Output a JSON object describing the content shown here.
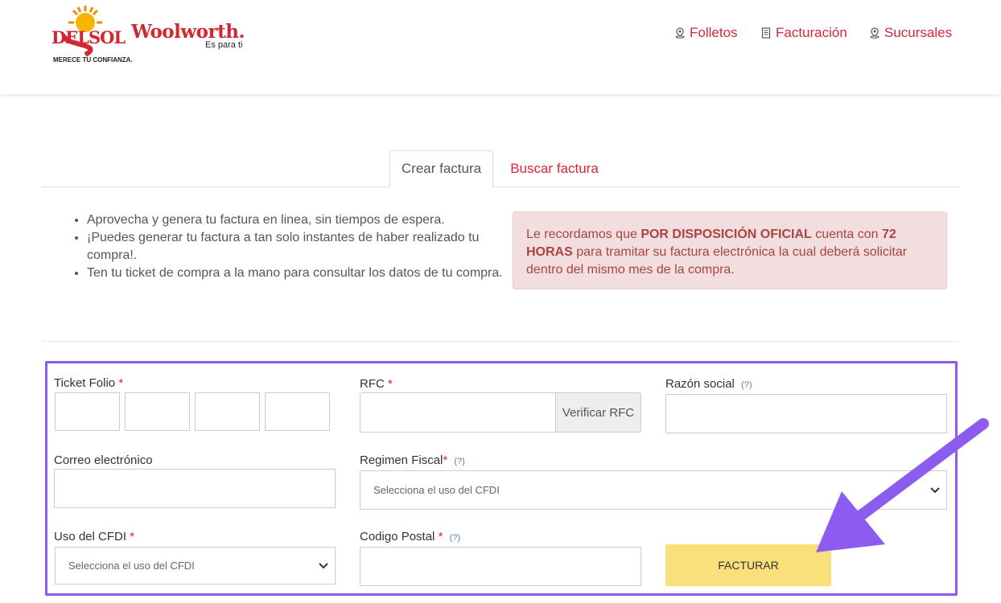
{
  "header": {
    "logo_delsol": {
      "word": "DELSOL",
      "tagline": "MERECE TU CONFIANZA."
    },
    "logo_woolworth": {
      "brand": "Woolworth.",
      "tagline": "Es para ti"
    },
    "nav": [
      {
        "label": "Folletos",
        "icon": "map-pin-icon"
      },
      {
        "label": "Facturación",
        "icon": "document-icon"
      },
      {
        "label": "Sucursales",
        "icon": "map-pin-icon"
      }
    ]
  },
  "tabs": [
    {
      "label": "Crear factura",
      "active": true
    },
    {
      "label": "Buscar factura",
      "active": false
    }
  ],
  "info": {
    "items": [
      "Aprovecha y genera tu factura en linea, sin tiempos de espera.",
      "¡Puedes generar tu factura a tan solo instantes de haber realizado tu compra!.",
      "Ten tu ticket de compra a la mano para consultar los datos de tu compra."
    ]
  },
  "alert": {
    "pre": "Le recordamos que ",
    "bold1": "POR DISPOSICIÓN OFICIAL",
    "mid": " cuenta con ",
    "bold2": "72 HORAS",
    "post": " para tramitar su factura electrónica la cual deberá solicitar dentro del mismo mes de la compra."
  },
  "form": {
    "ticket_folio": {
      "label": "Ticket Folio",
      "required": "*"
    },
    "rfc": {
      "label": "RFC",
      "required": "*",
      "verify_button": "Verificar RFC"
    },
    "razon_social": {
      "label": "Razón social",
      "help": "(?)"
    },
    "correo": {
      "label": "Correo electrónico"
    },
    "regimen": {
      "label": "Regimen Fiscal",
      "required": "*",
      "help": "(?)",
      "placeholder": "Selecciona el uso del CFDI"
    },
    "uso_cfdi": {
      "label": "Uso del CFDI",
      "required": "*",
      "placeholder": "Selecciona el uso del CFDI"
    },
    "codigo_postal": {
      "label": "Codigo Postal",
      "required": "*",
      "help": "(?)"
    },
    "submit": "FACTURAR"
  },
  "colors": {
    "brand_red": "#d6263b",
    "highlight_frame": "#8c5cf0",
    "submit_yellow": "#f9e07a",
    "alert_bg": "#f2dede"
  }
}
